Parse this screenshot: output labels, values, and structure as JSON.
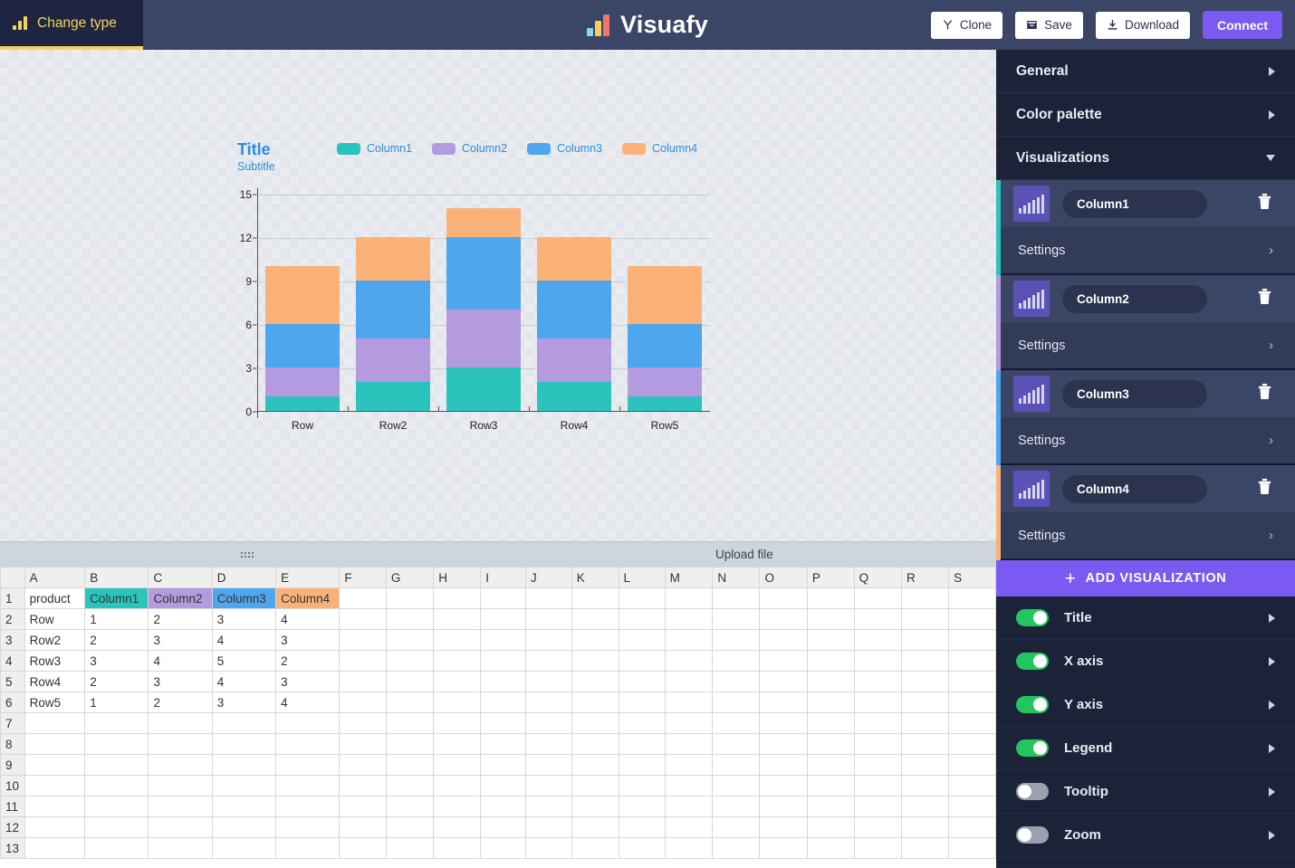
{
  "topbar": {
    "change_type": "Change type",
    "brand": "Visuafy",
    "buttons": [
      {
        "label": "Clone",
        "icon": "fork-icon"
      },
      {
        "label": "Save",
        "icon": "save-icon"
      },
      {
        "label": "Download",
        "icon": "download-icon"
      }
    ],
    "connect": "Connect"
  },
  "chart_data": {
    "type": "bar",
    "stacked": true,
    "title": "Title",
    "subtitle": "Subtitle",
    "categories": [
      "Row",
      "Row2",
      "Row3",
      "Row4",
      "Row5"
    ],
    "series": [
      {
        "name": "Column1",
        "color": "#2bc4bd",
        "values": [
          1,
          2,
          3,
          2,
          1
        ]
      },
      {
        "name": "Column2",
        "color": "#b49be0",
        "values": [
          2,
          3,
          4,
          3,
          2
        ]
      },
      {
        "name": "Column3",
        "color": "#4ea6ef",
        "values": [
          3,
          4,
          5,
          4,
          3
        ]
      },
      {
        "name": "Column4",
        "color": "#fab278",
        "values": [
          4,
          3,
          2,
          3,
          4
        ]
      }
    ],
    "totals": [
      10,
      12,
      14,
      12,
      10
    ],
    "ylim": [
      0,
      15
    ],
    "yticks": [
      0,
      3,
      6,
      9,
      12,
      15
    ],
    "xlabel": "",
    "ylabel": "",
    "grid": true,
    "legend_position": "top"
  },
  "splitter": {
    "upload_file": "Upload file"
  },
  "sheet": {
    "columns": [
      "A",
      "B",
      "C",
      "D",
      "E",
      "F",
      "G",
      "H",
      "I",
      "J",
      "K",
      "L",
      "M",
      "N",
      "O",
      "P",
      "Q",
      "R",
      "S"
    ],
    "row_numbers": [
      "1",
      "2",
      "3",
      "4",
      "5",
      "6",
      "7",
      "8",
      "9",
      "10",
      "11",
      "12",
      "13"
    ],
    "header_row": [
      "product",
      "Column1",
      "Column2",
      "Column3",
      "Column4"
    ],
    "header_colors": [
      "",
      "#2bc4bd",
      "#b49be0",
      "#4ea6ef",
      "#fab278"
    ],
    "rows": [
      [
        "Row",
        "1",
        "2",
        "3",
        "4"
      ],
      [
        "Row2",
        "2",
        "3",
        "4",
        "3"
      ],
      [
        "Row3",
        "3",
        "4",
        "5",
        "2"
      ],
      [
        "Row4",
        "2",
        "3",
        "4",
        "3"
      ],
      [
        "Row5",
        "1",
        "2",
        "3",
        "4"
      ]
    ]
  },
  "panel": {
    "sections": [
      {
        "label": "General",
        "state": "collapsed"
      },
      {
        "label": "Color palette",
        "state": "collapsed"
      },
      {
        "label": "Visualizations",
        "state": "expanded"
      }
    ],
    "settings_label": "Settings",
    "visualizations": [
      {
        "name": "Column1",
        "accent": "#2bc4bd"
      },
      {
        "name": "Column2",
        "accent": "#b49be0"
      },
      {
        "name": "Column3",
        "accent": "#4ea6ef"
      },
      {
        "name": "Column4",
        "accent": "#fab278"
      }
    ],
    "add_visualization": "ADD VISUALIZATION",
    "options": [
      {
        "label": "Title",
        "on": true
      },
      {
        "label": "X axis",
        "on": true
      },
      {
        "label": "Y axis",
        "on": true
      },
      {
        "label": "Legend",
        "on": true
      },
      {
        "label": "Tooltip",
        "on": false
      },
      {
        "label": "Zoom",
        "on": false
      }
    ]
  }
}
